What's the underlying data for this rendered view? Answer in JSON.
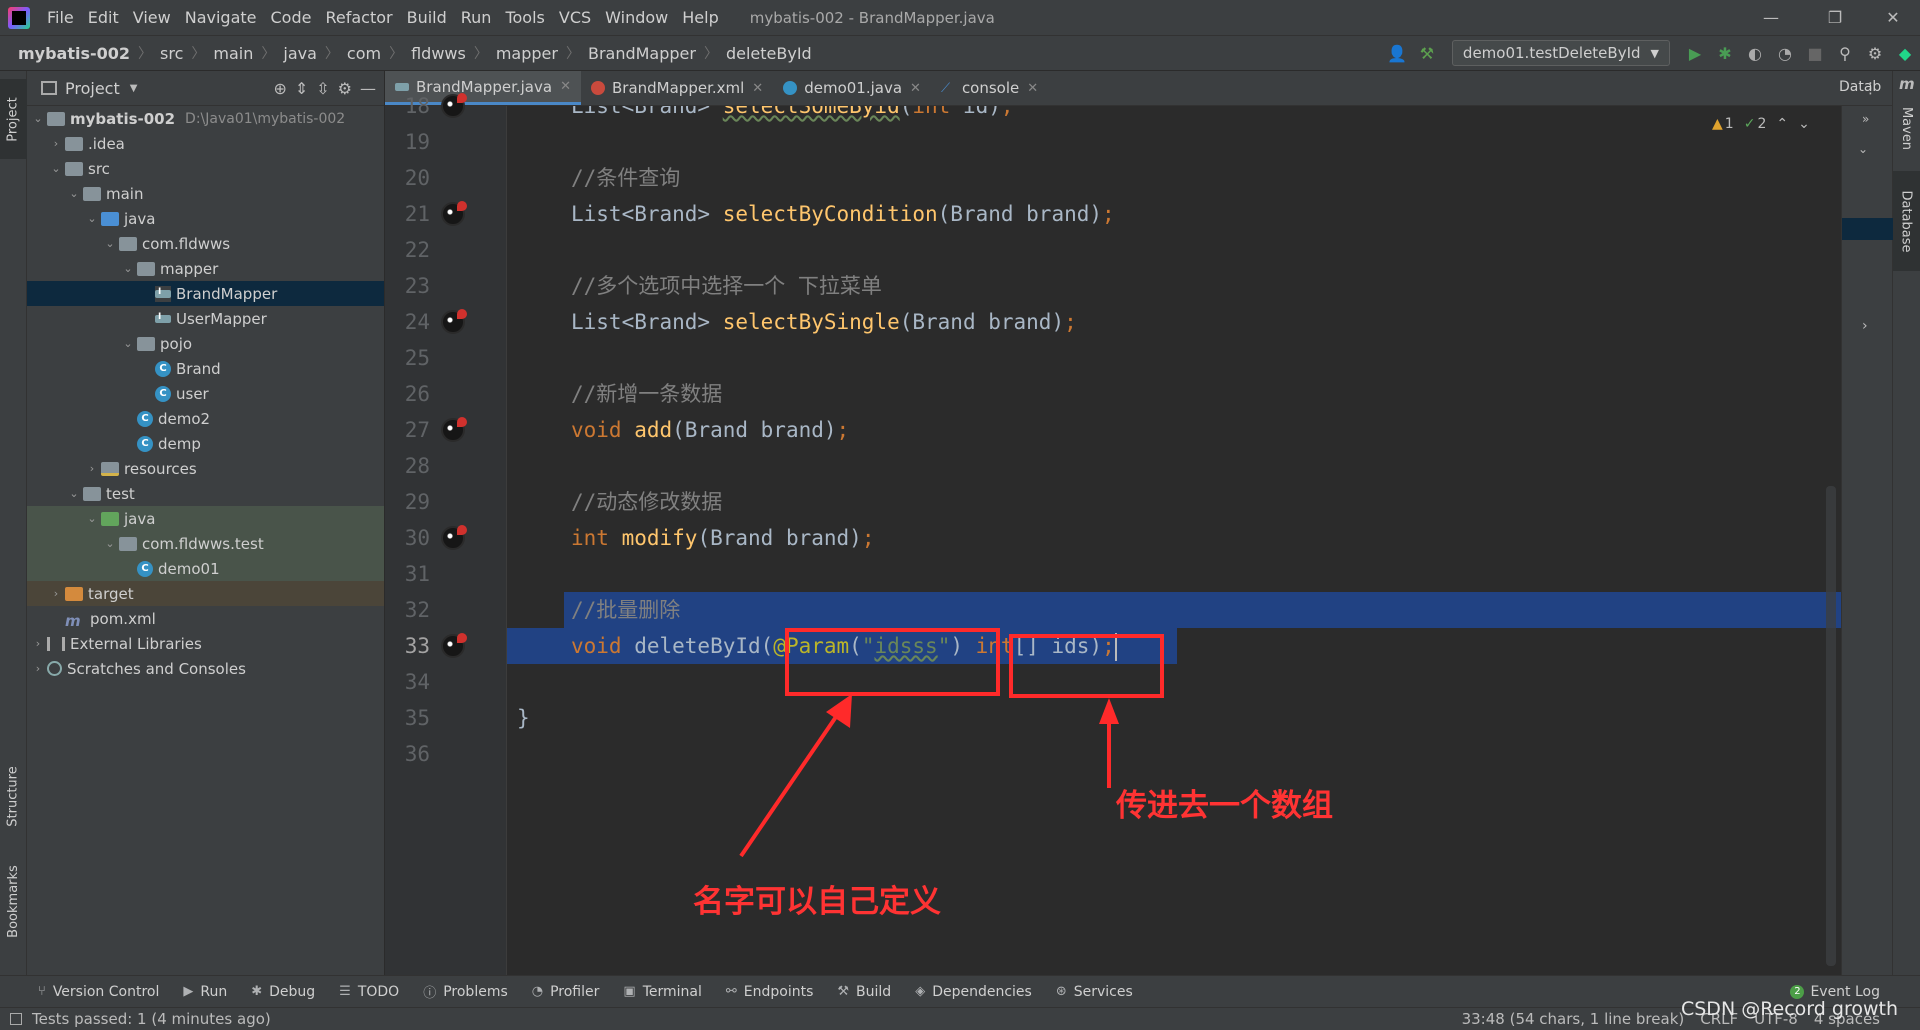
{
  "menubar": {
    "items": [
      "File",
      "Edit",
      "View",
      "Navigate",
      "Code",
      "Refactor",
      "Build",
      "Run",
      "Tools",
      "VCS",
      "Window",
      "Help"
    ],
    "title": "mybatis-002 - BrandMapper.java"
  },
  "navbar": {
    "breadcrumbs": [
      "mybatis-002",
      "src",
      "main",
      "java",
      "com",
      "fldwws",
      "mapper",
      "BrandMapper",
      "deleteById"
    ],
    "run_config": "demo01.testDeleteById"
  },
  "left_strip": {
    "project": "Project",
    "structure": "Structure",
    "bookmarks": "Bookmarks"
  },
  "right_strip": {
    "datab": "Datab",
    "maven": "Maven",
    "database": "Database"
  },
  "project_panel": {
    "title": "Project",
    "tree": [
      {
        "label": "mybatis-002",
        "extra": "D:\\Java01\\mybatis-002"
      },
      {
        "label": ".idea"
      },
      {
        "label": "src"
      },
      {
        "label": "main"
      },
      {
        "label": "java"
      },
      {
        "label": "com.fldwws"
      },
      {
        "label": "mapper"
      },
      {
        "label": "BrandMapper"
      },
      {
        "label": "UserMapper"
      },
      {
        "label": "pojo"
      },
      {
        "label": "Brand"
      },
      {
        "label": "user"
      },
      {
        "label": "demo2"
      },
      {
        "label": "demp"
      },
      {
        "label": "resources"
      },
      {
        "label": "test"
      },
      {
        "label": "java"
      },
      {
        "label": "com.fldwws.test"
      },
      {
        "label": "demo01"
      },
      {
        "label": "target"
      },
      {
        "label": "pom.xml"
      },
      {
        "label": "External Libraries"
      },
      {
        "label": "Scratches and Consoles"
      }
    ]
  },
  "editor_tabs": [
    {
      "label": "BrandMapper.java",
      "active": true
    },
    {
      "label": "BrandMapper.xml",
      "active": false
    },
    {
      "label": "demo01.java",
      "active": false
    },
    {
      "label": "console",
      "active": false
    }
  ],
  "inspection": {
    "warnings": "1",
    "weak_warnings": "2"
  },
  "code": {
    "line_numbers": [
      "18",
      "19",
      "20",
      "21",
      "22",
      "23",
      "24",
      "25",
      "26",
      "27",
      "28",
      "29",
      "30",
      "31",
      "32",
      "33",
      "34",
      "35",
      "36"
    ],
    "l18": {
      "type": "List<Brand> ",
      "fn": "selectSomeByid",
      "p1": "(",
      "p2": "int",
      "p3": " id)",
      "semi": ";"
    },
    "l20": {
      "comment": "//条件查询"
    },
    "l21": {
      "type": "List<Brand> ",
      "fn": "selectByCondition",
      "p1": "(Brand brand)",
      "semi": ";"
    },
    "l23": {
      "comment": "//多个选项中选择一个 下拉菜单"
    },
    "l24": {
      "type": "List<Brand> ",
      "fn": "selectBySingle",
      "p1": "(Brand brand)",
      "semi": ";"
    },
    "l26": {
      "comment": "//新增一条数据"
    },
    "l27": {
      "kw": "void ",
      "fn": "add",
      "p1": "(Brand brand)",
      "semi": ";"
    },
    "l29": {
      "comment": "//动态修改数据"
    },
    "l30": {
      "kw": "int ",
      "fn": "modify",
      "p1": "(Brand brand)",
      "semi": ";"
    },
    "l32": {
      "comment": "//批量删除"
    },
    "l33": {
      "kw": "void ",
      "name": "deleteById(",
      "ann": "@Param",
      "p": "(",
      "q1": "\"",
      "str": "idsss",
      "q2": "\"",
      "p2": ") ",
      "kw2": "int",
      "p3": "[] ids)",
      "semi": ";"
    },
    "l35": {
      "brace": "}"
    }
  },
  "annotations": {
    "array_note": "传进去一个数组",
    "name_note": "名字可以自己定义",
    "color": "#ff2a2a"
  },
  "bottom_tools": [
    "Version Control",
    "Run",
    "Debug",
    "TODO",
    "Problems",
    "Profiler",
    "Terminal",
    "Endpoints",
    "Build",
    "Dependencies",
    "Services"
  ],
  "event_log": {
    "count": "2",
    "label": "Event Log"
  },
  "statusbar": {
    "left": "Tests passed: 1 (4 minutes ago)",
    "position": "33:48 (54 chars, 1 line break)",
    "line_sep": "CRLF",
    "encoding": "UTF-8",
    "indent": "4 spaces"
  },
  "watermark": "CSDN @Record growth",
  "colors": {
    "selection": "#214283",
    "keyword": "#cc7832",
    "function": "#ffc66d",
    "comment": "#808080",
    "annotation": "#bbb529",
    "string": "#6a8759"
  }
}
